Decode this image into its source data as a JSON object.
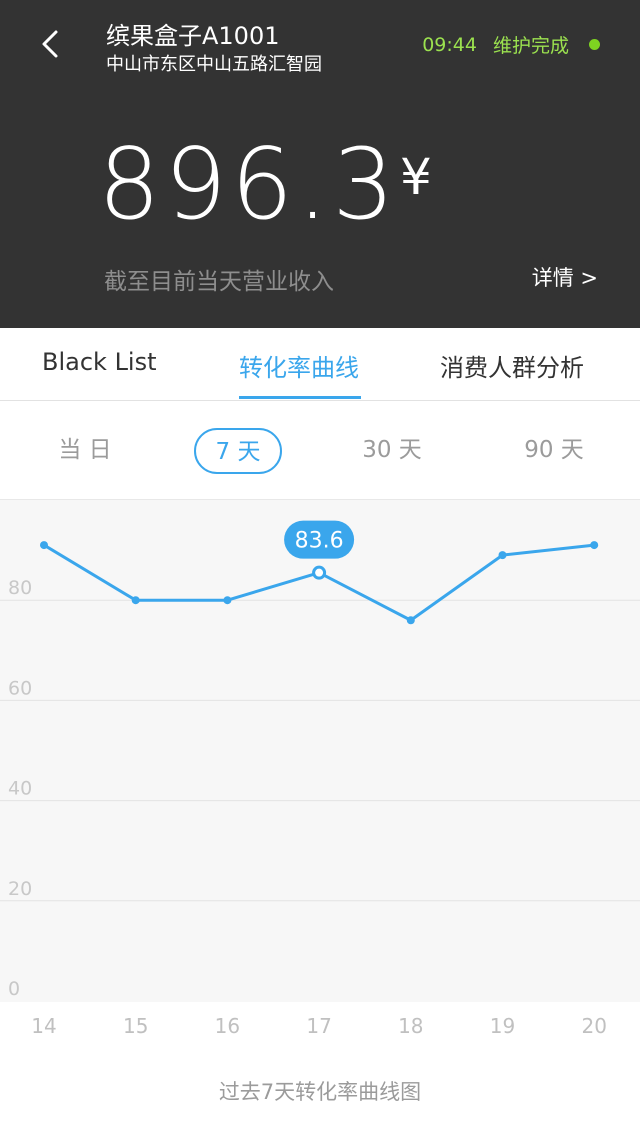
{
  "header": {
    "title": "缤果盒子A1001",
    "address": "中山市东区中山五路汇智园",
    "time": "09:44",
    "status": "维护完成",
    "amount": "896.3",
    "currency": "¥",
    "caption": "截至目前当天营业收入",
    "details_label": "详情 >"
  },
  "tabs": [
    {
      "label": "Black List",
      "active": false
    },
    {
      "label": "转化率曲线",
      "active": true
    },
    {
      "label": "消费人群分析",
      "active": false
    }
  ],
  "ranges": [
    {
      "label": "当 日",
      "active": false
    },
    {
      "label": "7 天",
      "active": true
    },
    {
      "label": "30 天",
      "active": false
    },
    {
      "label": "90 天",
      "active": false
    }
  ],
  "colors": {
    "accent": "#3aa6ec",
    "header_bg": "#333333",
    "status_green": "#7ed321"
  },
  "chart_data": {
    "type": "line",
    "categories": [
      "14",
      "15",
      "16",
      "17",
      "18",
      "19",
      "20"
    ],
    "values": [
      91,
      80,
      80,
      85.5,
      76,
      89,
      91
    ],
    "highlight_index": 3,
    "highlight_label": "83.6",
    "yticks": [
      "0",
      "20",
      "40",
      "60",
      "80"
    ],
    "ylim": [
      0,
      100
    ],
    "grid": true
  },
  "footer": {
    "caption": "过去7天转化率曲线图"
  }
}
